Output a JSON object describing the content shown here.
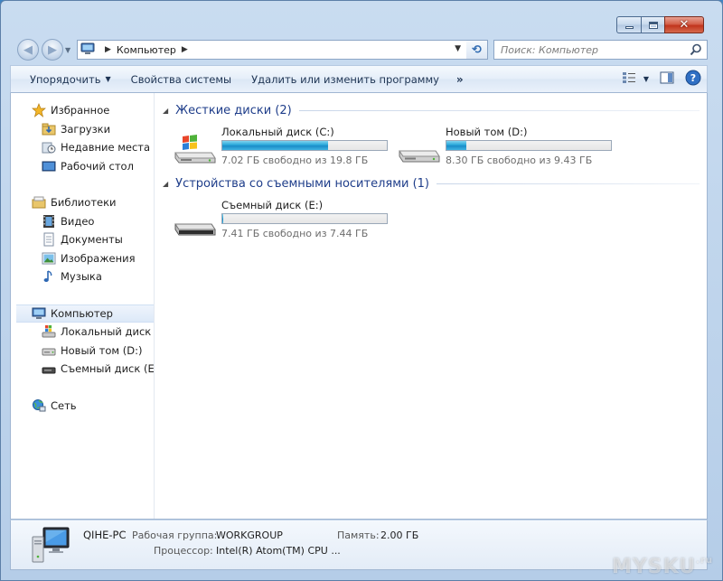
{
  "window": {
    "close_symbol": "✕"
  },
  "address": {
    "crumbs": [
      "Компьютер"
    ],
    "refresh_symbol": "⟲",
    "search_placeholder": "Поиск: Компьютер"
  },
  "toolbar": {
    "organize_label": "Упорядочить",
    "system_props_label": "Свойства системы",
    "uninstall_label": "Удалить или изменить программу",
    "more_label": "»"
  },
  "sidebar": {
    "favorites": {
      "label": "Избранное",
      "items": [
        {
          "label": "Загрузки",
          "icon": "downloads-folder-icon"
        },
        {
          "label": "Недавние места",
          "icon": "recent-places-icon"
        },
        {
          "label": "Рабочий стол",
          "icon": "desktop-icon"
        }
      ]
    },
    "libraries": {
      "label": "Библиотеки",
      "items": [
        {
          "label": "Видео",
          "icon": "video-library-icon"
        },
        {
          "label": "Документы",
          "icon": "documents-library-icon"
        },
        {
          "label": "Изображения",
          "icon": "pictures-library-icon"
        },
        {
          "label": "Музыка",
          "icon": "music-library-icon"
        }
      ]
    },
    "computer": {
      "label": "Компьютер",
      "items": [
        {
          "label": "Локальный диск (C:)",
          "icon": "system-drive-icon"
        },
        {
          "label": "Новый том (D:)",
          "icon": "hard-drive-icon"
        },
        {
          "label": "Съемный диск (E:)",
          "icon": "removable-drive-icon"
        }
      ]
    },
    "network": {
      "label": "Сеть"
    }
  },
  "groups": {
    "hard_drives": {
      "title": "Жесткие диски (2)",
      "drives": [
        {
          "name": "Локальный диск (C:)",
          "free_text": "7.02 ГБ свободно из 19.8 ГБ",
          "used_fraction": 0.645
        },
        {
          "name": "Новый том (D:)",
          "free_text": "8.30 ГБ свободно из 9.43 ГБ",
          "used_fraction": 0.12
        }
      ]
    },
    "removable": {
      "title": "Устройства со съемными носителями (1)",
      "drives": [
        {
          "name": "Съемный диск (E:)",
          "free_text": "7.41 ГБ свободно из 7.44 ГБ",
          "used_fraction": 0.004
        }
      ]
    }
  },
  "details": {
    "pc_name": "QIHE-PC",
    "workgroup_label": "Рабочая группа:",
    "workgroup_value": "WORKGROUP",
    "memory_label": "Память:",
    "memory_value": "2.00 ГБ",
    "cpu_label": "Процессор:",
    "cpu_value": "Intel(R) Atom(TM) CPU ..."
  },
  "watermark": {
    "text": "MYSKU",
    "suffix": ".ru"
  },
  "colors": {
    "accent": "#1e3d8a",
    "bar_fill": "#27a6d9",
    "selection": "#dde9f8"
  }
}
